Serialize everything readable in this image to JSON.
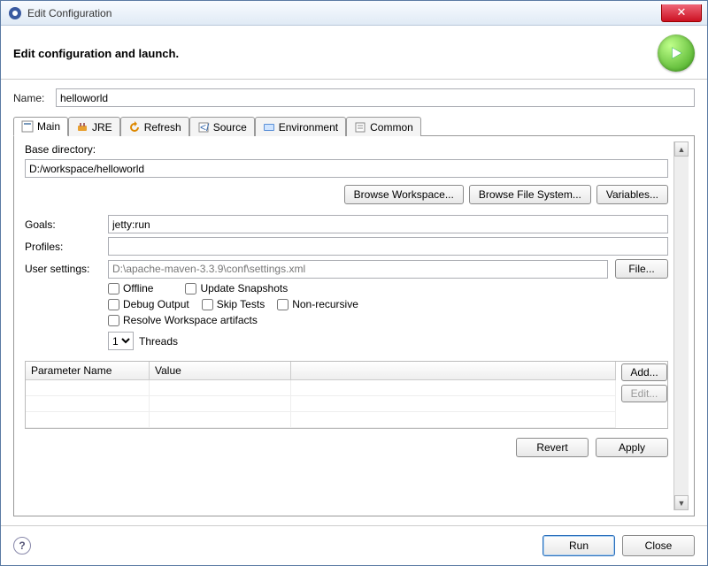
{
  "window": {
    "title": "Edit Configuration"
  },
  "header": {
    "heading": "Edit configuration and launch."
  },
  "fields": {
    "nameLabel": "Name:",
    "nameValue": "helloworld"
  },
  "tabs": [
    {
      "label": "Main"
    },
    {
      "label": "JRE"
    },
    {
      "label": "Refresh"
    },
    {
      "label": "Source"
    },
    {
      "label": "Environment"
    },
    {
      "label": "Common"
    }
  ],
  "main": {
    "baseDirLabel": "Base directory:",
    "baseDirValue": "D:/workspace/helloworld",
    "browseWorkspace": "Browse Workspace...",
    "browseFileSystem": "Browse File System...",
    "variables": "Variables...",
    "goalsLabel": "Goals:",
    "goalsValue": "jetty:run",
    "profilesLabel": "Profiles:",
    "profilesValue": "",
    "userSettingsLabel": "User settings:",
    "userSettingsValue": "D:\\apache-maven-3.3.9\\conf\\settings.xml",
    "fileBtn": "File...",
    "checks": {
      "offline": "Offline",
      "updateSnapshots": "Update Snapshots",
      "debugOutput": "Debug Output",
      "skipTests": "Skip Tests",
      "nonRecursive": "Non-recursive",
      "resolveWorkspace": "Resolve Workspace artifacts"
    },
    "threadsValue": "1",
    "threadsLabel": "Threads",
    "table": {
      "colName": "Parameter Name",
      "colValue": "Value",
      "addBtn": "Add...",
      "editBtn": "Edit..."
    },
    "revert": "Revert",
    "apply": "Apply"
  },
  "footer": {
    "run": "Run",
    "close": "Close"
  }
}
